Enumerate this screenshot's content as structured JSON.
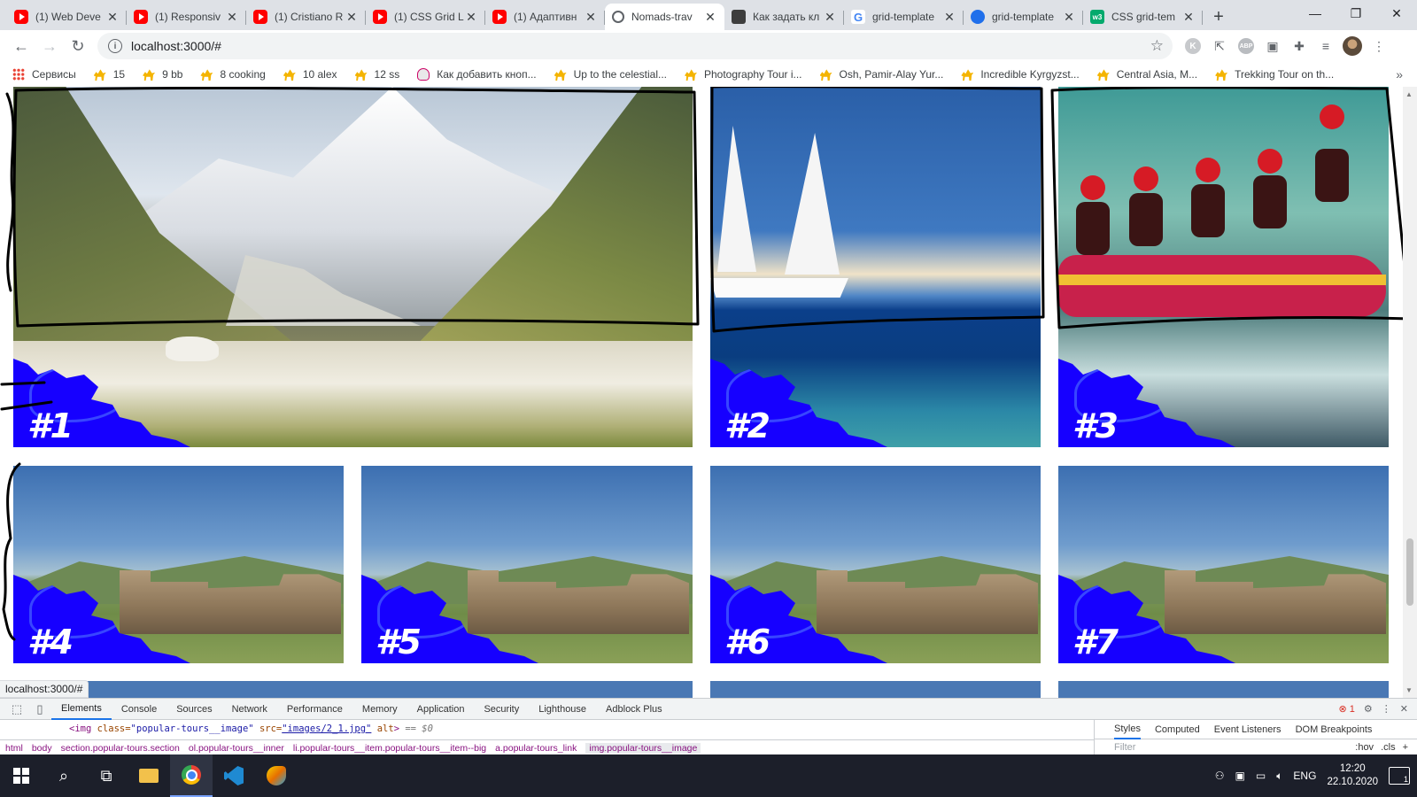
{
  "tabs": [
    {
      "favicon": "youtube-icon",
      "title": "(1) Web Deve",
      "active": false
    },
    {
      "favicon": "youtube-icon",
      "title": "(1) Responsiv",
      "active": false
    },
    {
      "favicon": "youtube-icon",
      "title": "(1) Cristiano R",
      "active": false
    },
    {
      "favicon": "youtube-icon",
      "title": "(1) CSS Grid L",
      "active": false
    },
    {
      "favicon": "youtube-icon",
      "title": "(1) Адаптивн",
      "active": false
    },
    {
      "favicon": "globe-icon",
      "title": "Nomads-trav",
      "active": true
    },
    {
      "favicon": "stackoverflow-icon",
      "title": "Как задать кл",
      "active": false
    },
    {
      "favicon": "google-icon",
      "title": "grid-template",
      "active": false
    },
    {
      "favicon": "github-icon",
      "title": "grid-template",
      "active": false
    },
    {
      "favicon": "w3schools-icon",
      "title": "CSS grid-tem",
      "active": false
    }
  ],
  "address": {
    "url": "localhost:3000/#"
  },
  "bookmarks": [
    {
      "icon": "apps-icon",
      "label": "Сервисы"
    },
    {
      "icon": "camel-icon",
      "label": "15"
    },
    {
      "icon": "camel-icon",
      "label": "9 bb"
    },
    {
      "icon": "camel-icon",
      "label": "8 cooking"
    },
    {
      "icon": "camel-icon",
      "label": "10 alex"
    },
    {
      "icon": "camel-icon",
      "label": "12 ss"
    },
    {
      "icon": "ghost-icon",
      "label": "Как добавить кноп..."
    },
    {
      "icon": "camel-icon",
      "label": "Up to the celestial..."
    },
    {
      "icon": "camel-icon",
      "label": "Photography Tour i..."
    },
    {
      "icon": "camel-icon",
      "label": "Osh, Pamir-Alay Yur..."
    },
    {
      "icon": "camel-icon",
      "label": "Incredible Kyrgyzst..."
    },
    {
      "icon": "camel-icon",
      "label": "Central Asia, M..."
    },
    {
      "icon": "camel-icon",
      "label": "Trekking Tour on th..."
    }
  ],
  "tours": [
    {
      "number": "#1",
      "scene": "mountain-glacier"
    },
    {
      "number": "#2",
      "scene": "sailing-boats"
    },
    {
      "number": "#3",
      "scene": "river-rafting"
    },
    {
      "number": "#4",
      "scene": "stone-fortress"
    },
    {
      "number": "#5",
      "scene": "stone-fortress"
    },
    {
      "number": "#6",
      "scene": "stone-fortress"
    },
    {
      "number": "#7",
      "scene": "stone-fortress"
    }
  ],
  "status_bar": {
    "url": "localhost:3000/#"
  },
  "devtools": {
    "tabs": [
      "Elements",
      "Console",
      "Sources",
      "Network",
      "Performance",
      "Memory",
      "Application",
      "Security",
      "Lighthouse",
      "Adblock Plus"
    ],
    "active_tab": "Elements",
    "error_count": "1",
    "code_line": {
      "tag_open": "<img ",
      "attr1_name": "class=",
      "attr1_value": "\"popular-tours__image\"",
      "attr2_name": " src=",
      "attr2_value": "\"images/2_1.jpg\"",
      "attr3": " alt",
      "tag_close": ">",
      "selected_marker": " == $0"
    },
    "breadcrumbs": [
      "html",
      "body",
      "section.popular-tours.section",
      "ol.popular-tours__inner",
      "li.popular-tours__item.popular-tours__item--big",
      "a.popular-tours_link",
      "img.popular-tours__image"
    ],
    "side_tabs": [
      "Styles",
      "Computed",
      "Event Listeners",
      "DOM Breakpoints"
    ],
    "filter_placeholder": "Filter",
    "filter_options": [
      ":hov",
      ".cls",
      "+"
    ]
  },
  "taskbar": {
    "language": "ENG",
    "time": "12:20",
    "date": "22.10.2020",
    "notifications": "1"
  },
  "colors": {
    "ornament_blue": "#1600ff",
    "tabstrip_bg": "#dee1e6",
    "devtools_accent": "#1a73e8",
    "taskbar_bg": "#1c1f2a"
  }
}
